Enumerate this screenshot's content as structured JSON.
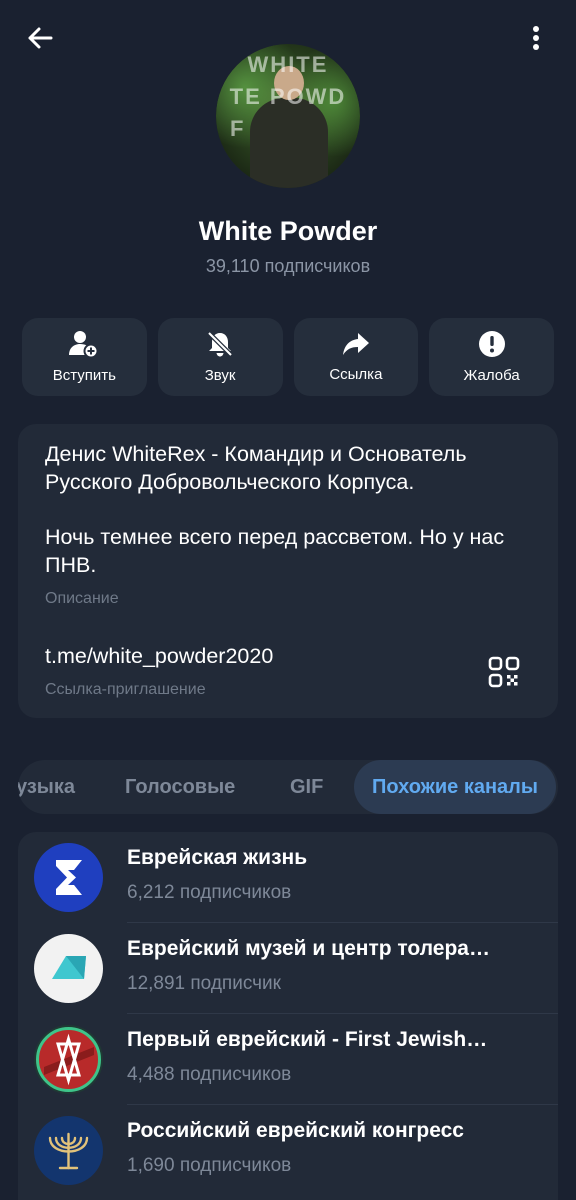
{
  "header": {
    "back_icon": "arrow-left-icon",
    "menu_icon": "more-vertical-icon"
  },
  "channel": {
    "title": "White Powder",
    "subscribers": "39,110 подписчиков",
    "avatar_watermark": [
      "WHITE",
      "TE POWD",
      "F"
    ]
  },
  "actions": [
    {
      "label": "Вступить",
      "icon": "add-user-icon"
    },
    {
      "label": "Звук",
      "icon": "bell-off-icon"
    },
    {
      "label": "Ссылка",
      "icon": "share-arrow-icon"
    },
    {
      "label": "Жалоба",
      "icon": "exclamation-circle-icon"
    }
  ],
  "info": {
    "description_lines": [
      "Денис WhiteRex - Командир и Основатель Русского Добровольческого Корпуса.",
      "Ночь темнее всего перед рассветом. Но у нас ПНВ."
    ],
    "description_label": "Описание",
    "link": "t.me/white_powder2020",
    "link_label": "Ссылка-приглашение",
    "qr_icon": "qr-code-icon"
  },
  "tabs": {
    "items": [
      "узыка",
      "Голосовые",
      "GIF",
      "Похожие каналы"
    ],
    "active": "Похожие каналы"
  },
  "similar_channels": [
    {
      "name": "Еврейская жизнь",
      "subs": "6,212 подписчиков"
    },
    {
      "name": "Еврейский музей и центр толера…",
      "subs": "12,891 подписчик"
    },
    {
      "name": "Первый еврейский - First Jewish…",
      "subs": "4,488 подписчиков"
    },
    {
      "name": "Российский еврейский конгресс",
      "subs": "1,690 подписчиков"
    }
  ],
  "colors": {
    "background": "#1a2130",
    "card": "#222a38",
    "accent": "#61aaf0",
    "secondary_text": "#8b95a5"
  }
}
